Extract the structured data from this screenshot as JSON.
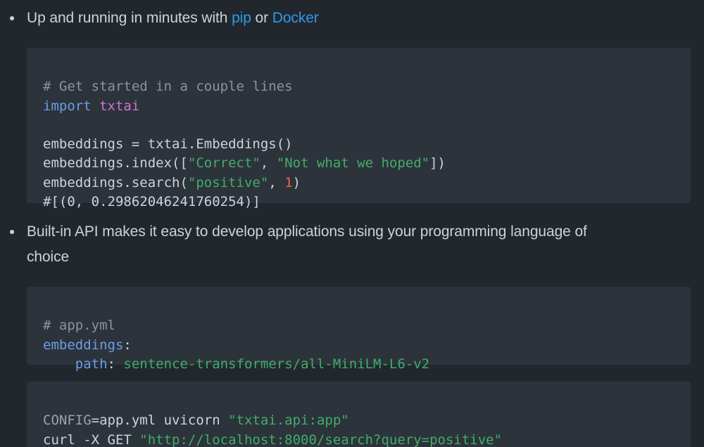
{
  "bullets": [
    {
      "prefix": "Up and running in minutes with ",
      "link1": "pip",
      "middle": " or ",
      "link2": "Docker"
    },
    {
      "line1": "Built-in API makes it easy to develop applications using your programming language of",
      "line2": "choice"
    }
  ],
  "code_python": {
    "comment": "# Get started in a couple lines",
    "import_kw": "import",
    "import_mod": "txtai",
    "line3": "embeddings = txtai.Embeddings()",
    "line4_a": "embeddings.index([",
    "line4_s1": "\"Correct\"",
    "line4_b": ", ",
    "line4_s2": "\"Not what we hoped\"",
    "line4_c": "])",
    "line5_a": "embeddings.search(",
    "line5_s": "\"positive\"",
    "line5_b": ", ",
    "line5_n": "1",
    "line5_c": ")",
    "line6": "#[(0, 0.29862046241760254)]"
  },
  "code_yaml": {
    "comment": "# app.yml",
    "key1": "embeddings",
    "colon1": ":",
    "indent": "    ",
    "key2": "path",
    "colon2": ": ",
    "value": "sentence-transformers/all-MiniLM-L6-v2"
  },
  "code_shell": {
    "env": "CONFIG",
    "env_rest": "=app.yml uvicorn ",
    "app_str": "\"txtai.api:app\"",
    "curl_cmd": "curl -X GET ",
    "url_str": "\"http://localhost:8000/search?query=positive\""
  },
  "colors": {
    "background": "#22272e",
    "code_background": "#2d333b",
    "link": "#2f9ae6",
    "string": "#3fae6a",
    "keyword": "#6b9ee8",
    "module": "#d071d8",
    "number": "#f0624b",
    "comment": "#8b939c"
  }
}
